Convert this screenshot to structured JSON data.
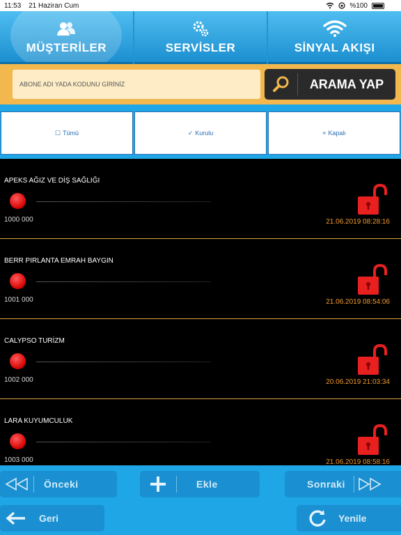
{
  "status_bar": {
    "time": "11:53",
    "date": "21 Haziran Cum",
    "battery": "%100"
  },
  "nav": {
    "tabs": [
      {
        "label": "MÜŞTERİLER",
        "icon": "users-icon"
      },
      {
        "label": "SERVİSLER",
        "icon": "gears-icon"
      },
      {
        "label": "SİNYAL AKIŞI",
        "icon": "wifi-icon"
      }
    ],
    "active_index": 0
  },
  "search": {
    "placeholder": "ABONE ADI YADA KODUNU GİRİNİZ",
    "button_label": "ARAMA YAP"
  },
  "filters": [
    {
      "mark": "☐",
      "label": "Tümü"
    },
    {
      "mark": "✓",
      "label": "Kurulu"
    },
    {
      "mark": "×",
      "label": "Kapalı"
    }
  ],
  "customers": [
    {
      "name": "APEKS AĞIZ VE DİŞ SAĞLIĞI",
      "code": "1000 000",
      "date": "21.06.2019 08:28:16",
      "status": "red",
      "lock": "unlocked"
    },
    {
      "name": "BERR PIRLANTA EMRAH BAYGIN",
      "code": "1001 000",
      "date": "21.06.2019 08:54:06",
      "status": "red",
      "lock": "unlocked"
    },
    {
      "name": "CALYPSO TURİZM",
      "code": "1002 000",
      "date": "20.06.2019 21:03:34",
      "status": "red",
      "lock": "unlocked"
    },
    {
      "name": "LARA KUYUMCULUK",
      "code": "1003 000",
      "date": "21.06.2019 08:58:16",
      "status": "red",
      "lock": "unlocked"
    }
  ],
  "pager": {
    "prev_label": "Önceki",
    "add_label": "Ekle",
    "next_label": "Sonraki"
  },
  "bottom": {
    "back_label": "Geri",
    "refresh_label": "Yenile"
  },
  "colors": {
    "accent": "#1ea6e6",
    "search_bg": "#f2b84d",
    "status_red": "#e02020",
    "date_orange": "#f29a2e"
  }
}
